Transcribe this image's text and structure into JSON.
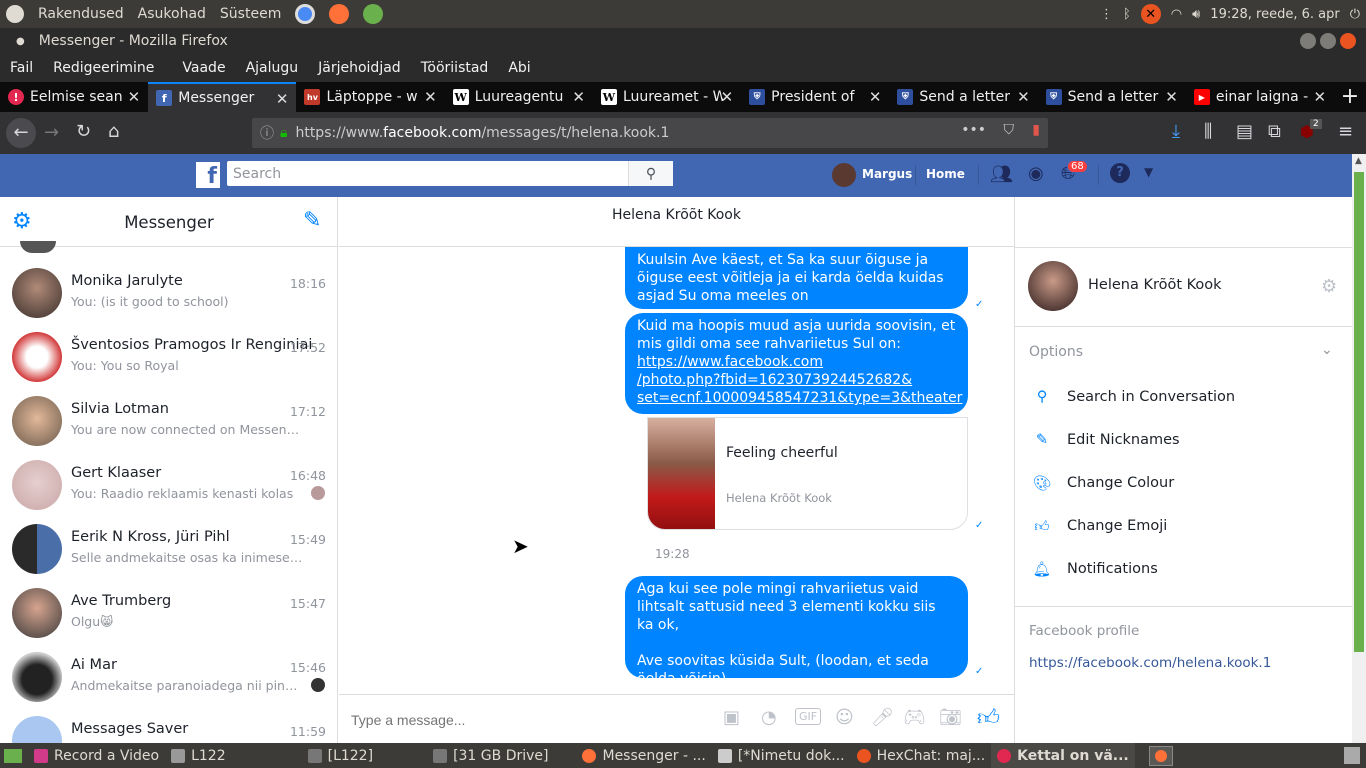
{
  "os_bar": {
    "menus": [
      "Rakendused",
      "Asukohad",
      "Süsteem"
    ],
    "clock": "19:28, reede, 6. apr"
  },
  "window": {
    "title": "Messenger - Mozilla Firefox"
  },
  "menubar": [
    "Fail",
    "Redigeerimine",
    "Vaade",
    "Ajalugu",
    "Järjehoidjad",
    "Tööriistad",
    "Abi"
  ],
  "tabs": [
    {
      "label": "Eelmise sean",
      "icon": "warning-icon",
      "color": "#e22850"
    },
    {
      "label": "Messenger",
      "icon": "facebook-icon",
      "color": "#4267b2"
    },
    {
      "label": "Läptoppe - w",
      "icon": "site-icon",
      "color": "#c0392b"
    },
    {
      "label": "Luureagentu",
      "icon": "wikipedia-icon",
      "color": "#ffffff"
    },
    {
      "label": "Luureamet - W",
      "icon": "wikipedia-icon",
      "color": "#ffffff"
    },
    {
      "label": "President of",
      "icon": "shield-icon",
      "color": "#2d4f9e"
    },
    {
      "label": "Send a letter",
      "icon": "shield-icon",
      "color": "#2d4f9e"
    },
    {
      "label": "Send a letter",
      "icon": "shield-icon",
      "color": "#2d4f9e"
    },
    {
      "label": "einar laigna -",
      "icon": "youtube-icon",
      "color": "#ff0000"
    }
  ],
  "url": {
    "prefix": "https://www.",
    "domain": "facebook.com",
    "path": "/messages/t/helena.kook.1"
  },
  "ublock_count": "2",
  "fb": {
    "search_placeholder": "Search",
    "user": "Margus",
    "home": "Home",
    "notifications": "68"
  },
  "sidebar": {
    "title": "Messenger",
    "conversations": [
      {
        "name": "Monika Jarulyte",
        "time": "18:16",
        "preview": "You: (is it good to school)"
      },
      {
        "name": "Šventosios Pramogos Ir Renginiai",
        "time": "17:52",
        "preview": "You: You so Royal"
      },
      {
        "name": "Silvia Lotman",
        "time": "17:12",
        "preview": "You are now connected on Messenger."
      },
      {
        "name": "Gert Klaaser",
        "time": "16:48",
        "preview": "You: Raadio reklaamis kenasti kolas"
      },
      {
        "name": "Eerik N Kross, Jüri Pihl",
        "time": "15:49",
        "preview": "Selle andmekaitse osas ka inimesed ..."
      },
      {
        "name": "Ave Trumberg",
        "time": "15:47",
        "preview": "Olgu😸"
      },
      {
        "name": "Ai Mar",
        "time": "15:46",
        "preview": "Andmekaitse paranoiadega nii pinges..."
      },
      {
        "name": "Messages Saver",
        "time": "11:59",
        "preview": ""
      }
    ]
  },
  "chat": {
    "contact": "Helena Krõõt Kook",
    "msg1": "Kuulsin Ave käest, et Sa ka suur õiguse ja õiguse eest võitleja ja ei karda öelda kuidas asjad Su oma meeles on",
    "msg2_text": "Kuid ma hoopis muud asja uurida soovisin, et mis gildi oma see rahvariietus Sul on:",
    "msg2_link": "https://www.facebook.com/photo.php?fbid=1623073924452682&set=ecnf.100009458547231&type=3&theater",
    "msg2_link_lines": [
      "https://www.facebook.com",
      "/photo.php?fbid=1623073924452682&",
      "set=ecnf.100009458547231&type=3&theater"
    ],
    "card_title": "Feeling cheerful",
    "card_sub": "Helena Krõõt Kook",
    "timestamp": "19:28",
    "msg3_line1": "Aga kui see pole mingi rahvariietus vaid lihtsalt sattusid need 3 elementi kokku siis ka ok,",
    "msg3_line2": "Ave soovitas küsida Sult, (loodan, et seda öelda võisin)",
    "input_placeholder": "Type a message..."
  },
  "details": {
    "name": "Helena Krõõt Kook",
    "options_label": "Options",
    "options": [
      "Search in Conversation",
      "Edit Nicknames",
      "Change Colour",
      "Change Emoji",
      "Notifications"
    ],
    "profile_label": "Facebook profile",
    "profile_url": "https://facebook.com/helena.kook.1"
  },
  "taskbar": [
    {
      "label": "Record a Video"
    },
    {
      "label": "L122"
    },
    {
      "label": "[L122]"
    },
    {
      "label": "[31 GB Drive]"
    },
    {
      "label": "Messenger - ..."
    },
    {
      "label": "[*Nimetu dok..."
    },
    {
      "label": "HexChat: maj..."
    },
    {
      "label": "Kettal on vä..."
    }
  ],
  "colors": {
    "fb_blue": "#4267b2",
    "messenger_blue": "#0084ff",
    "ubuntu_dark": "#3c3b37"
  }
}
